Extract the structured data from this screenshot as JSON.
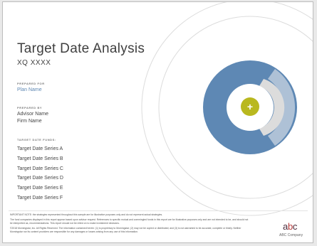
{
  "report": {
    "title": "Target Date Analysis",
    "subtitle": "XQ XXXX"
  },
  "prepared_for": {
    "label": "PREPARED FOR",
    "value": "Plan Name"
  },
  "prepared_by": {
    "label": "PREPARED BY",
    "advisor_name": "Advisor Name",
    "firm_name": "Firm Name"
  },
  "target_date_funds": {
    "label": "TARGET DATE FUNDS:",
    "items": [
      "Target Date Series A",
      "Target Date Series B",
      "Target Date Series C",
      "Target Date Series D",
      "Target Date Series E",
      "Target Date Series F"
    ]
  },
  "disclaimer": {
    "line1": "IMPORTANT NOTE: the strategies represented throughout this sample are for illustrative purposes only and do not represent actual strategies.",
    "line2": "The fund companies displayed in this report appear based upon advisor request. References to specific mutual and commingled funds in this report are for illustrative purposes only and are not intended to be, and should not be interpreted as, recommendations. This report should not be relied on to make investment decisions.",
    "line3": "©2018 Morningstar, Inc. All Rights Reserved. The information contained herein: (1) is proprietary to Morningstar; (2) may not be copied or distributed; and (3) is not warranted to be accurate, complete or timely. Neither Morningstar nor its content providers are responsible for any damages or losses arising from any use of this information."
  },
  "logo": {
    "mark": "abc",
    "mark_a": "a",
    "mark_b": "b",
    "mark_c": "c",
    "company": "ABC Company"
  },
  "graphic": {
    "center_symbol": "+",
    "colors": {
      "outer_ring_stroke": "#dcdcdc",
      "main_disc": "#5e88b4",
      "inner_ring_light": "#c9c9c9",
      "center_white": "#ffffff",
      "center_dot": "#b9b81f"
    }
  }
}
